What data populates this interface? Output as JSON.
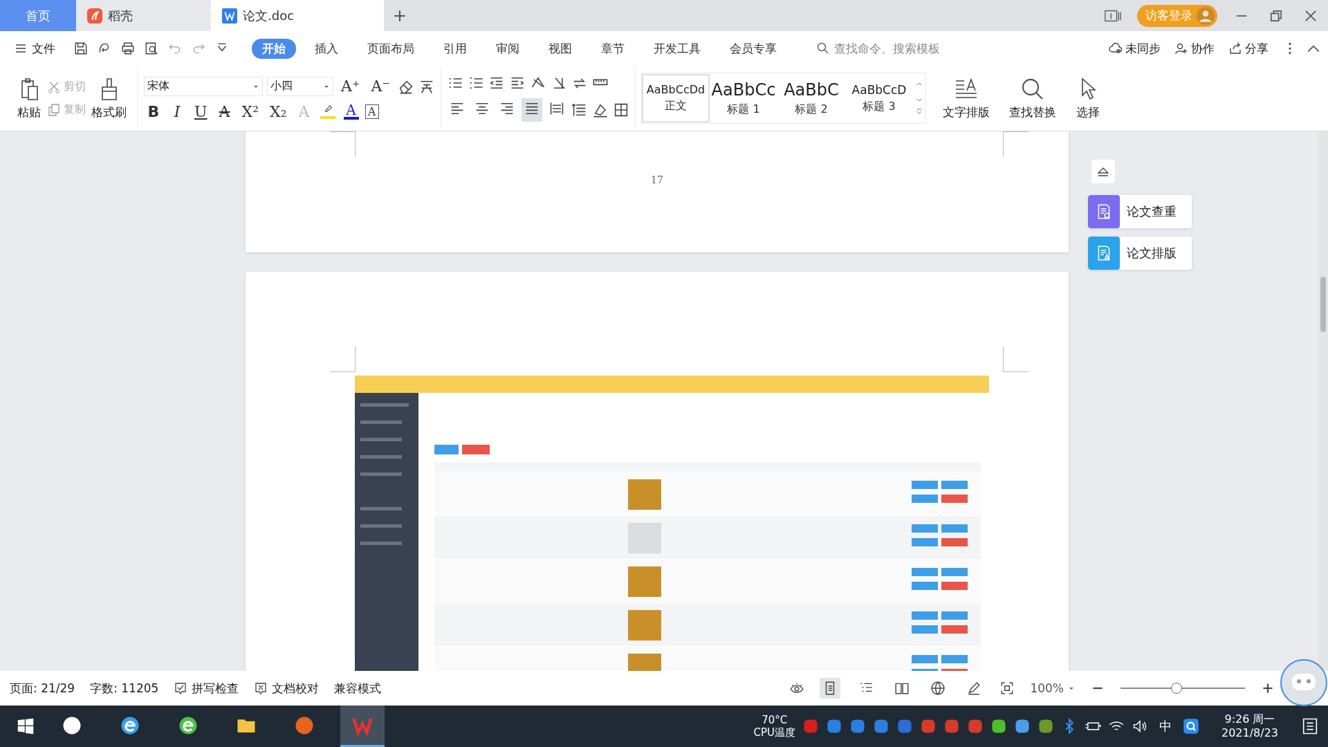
{
  "tabs": [
    {
      "kind": "home",
      "label": "首页",
      "selected": false
    },
    {
      "kind": "app",
      "label": "稻壳",
      "selected": false
    },
    {
      "kind": "doc",
      "label": "论文.doc",
      "selected": true
    }
  ],
  "account": {
    "login_label": "访客登录"
  },
  "menu": {
    "file_label": "文件",
    "ribbon_tabs": [
      {
        "label": "开始",
        "selected": true
      },
      {
        "label": "插入",
        "selected": false
      },
      {
        "label": "页面布局",
        "selected": false
      },
      {
        "label": "引用",
        "selected": false
      },
      {
        "label": "审阅",
        "selected": false
      },
      {
        "label": "视图",
        "selected": false
      },
      {
        "label": "章节",
        "selected": false
      },
      {
        "label": "开发工具",
        "selected": false
      },
      {
        "label": "会员专享",
        "selected": false
      }
    ],
    "search": {
      "placeholder": "查找命令、搜索模板"
    },
    "actions": [
      {
        "kind": "sync",
        "label": "未同步"
      },
      {
        "kind": "collab",
        "label": "协作"
      },
      {
        "kind": "share",
        "label": "分享"
      }
    ]
  },
  "ribbon": {
    "paste_label": "粘贴",
    "clip": [
      {
        "kind": "cut",
        "label": "剪切",
        "disabled": true
      },
      {
        "kind": "copy",
        "label": "复制",
        "disabled": true
      }
    ],
    "format_painter_label": "格式刷",
    "font": {
      "value": "宋体"
    },
    "size": {
      "value": "小四"
    },
    "grow_buttons": [
      "A⁺",
      "A⁻"
    ],
    "format_buttons": [
      {
        "kind": "bold",
        "label": "B"
      },
      {
        "kind": "italic",
        "label": "I"
      },
      {
        "kind": "underline",
        "label": "U"
      },
      {
        "kind": "strike",
        "label": "A"
      },
      {
        "kind": "plain",
        "label": "X²"
      },
      {
        "kind": "plain",
        "label": "X₂"
      },
      {
        "kind": "effect",
        "label": "A"
      }
    ],
    "color_buttons": [
      {
        "kind": "highlight",
        "color": "#f2e21c"
      },
      {
        "kind": "fontcolor",
        "label": "A",
        "color": "#1a1acc"
      }
    ],
    "char_border_label": "A",
    "align": [
      {
        "kind": "left",
        "selected": false
      },
      {
        "kind": "center",
        "selected": false
      },
      {
        "kind": "right",
        "selected": false
      },
      {
        "kind": "justify",
        "selected": true
      },
      {
        "kind": "distribute",
        "selected": false
      }
    ],
    "styles": [
      {
        "preview": "AaBbCcDd",
        "label": "正文",
        "kind": "body",
        "selected": true
      },
      {
        "preview": "AaBbCc",
        "label": "标题 1",
        "kind": "h1",
        "selected": false
      },
      {
        "preview": "AaBbC",
        "label": "标题 2",
        "kind": "h2",
        "selected": false
      },
      {
        "preview": "AaBbCcD",
        "label": "标题 3",
        "kind": "h3",
        "selected": false
      }
    ],
    "tools": [
      {
        "kind": "layout",
        "label": "文字排版"
      },
      {
        "kind": "find",
        "label": "查找替换"
      },
      {
        "kind": "select",
        "label": "选择"
      }
    ]
  },
  "document": {
    "page_number": "17"
  },
  "side_panel": [
    {
      "label": "论文查重",
      "kind": "check",
      "color": "#7b6cf0"
    },
    {
      "label": "论文排版",
      "kind": "format",
      "color": "#2aa3ea"
    }
  ],
  "status_bar": {
    "page": "页面: 21/29",
    "words": "字数: 11205",
    "spell_check": "拼写检查",
    "proofread": "文档校对",
    "mode": "兼容模式",
    "views": [
      {
        "kind": "page",
        "selected": true
      },
      {
        "kind": "outline",
        "selected": false
      },
      {
        "kind": "read",
        "selected": false
      },
      {
        "kind": "web",
        "selected": false
      },
      {
        "kind": "pen",
        "selected": false
      }
    ],
    "zoom": "100%",
    "zoom_slider": {
      "level": 0.45
    }
  },
  "taskbar": {
    "apps": [
      {
        "kind": "pinwheel",
        "active": false
      },
      {
        "kind": "ie",
        "active": false
      },
      {
        "kind": "browser",
        "active": false
      },
      {
        "kind": "folder",
        "active": false
      },
      {
        "kind": "raccoon",
        "active": false
      },
      {
        "kind": "wps",
        "active": true
      }
    ],
    "cpu_temp": "70°C",
    "cpu_label": "CPU温度",
    "ime": "中",
    "time": "9:26 周一",
    "date": "2021/8/23"
  }
}
